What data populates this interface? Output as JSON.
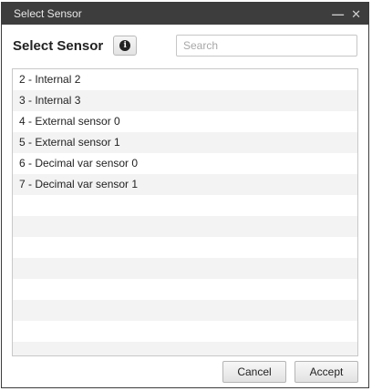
{
  "window": {
    "title": "Select Sensor",
    "minimize_label": "—",
    "close_label": "✕"
  },
  "header": {
    "heading": "Select Sensor",
    "info_icon": "info-circle-icon",
    "info_glyph": "i",
    "search_placeholder": "Search",
    "search_value": ""
  },
  "list": {
    "items": [
      {
        "label": "2 - Internal 2"
      },
      {
        "label": "3 - Internal 3"
      },
      {
        "label": "4 - External sensor 0"
      },
      {
        "label": "5 - External sensor 1"
      },
      {
        "label": "6 - Decimal var sensor 0"
      },
      {
        "label": "7 - Decimal var sensor 1"
      },
      {
        "label": ""
      },
      {
        "label": ""
      },
      {
        "label": ""
      },
      {
        "label": ""
      },
      {
        "label": ""
      },
      {
        "label": ""
      },
      {
        "label": ""
      },
      {
        "label": ""
      }
    ]
  },
  "footer": {
    "cancel_label": "Cancel",
    "accept_label": "Accept"
  }
}
